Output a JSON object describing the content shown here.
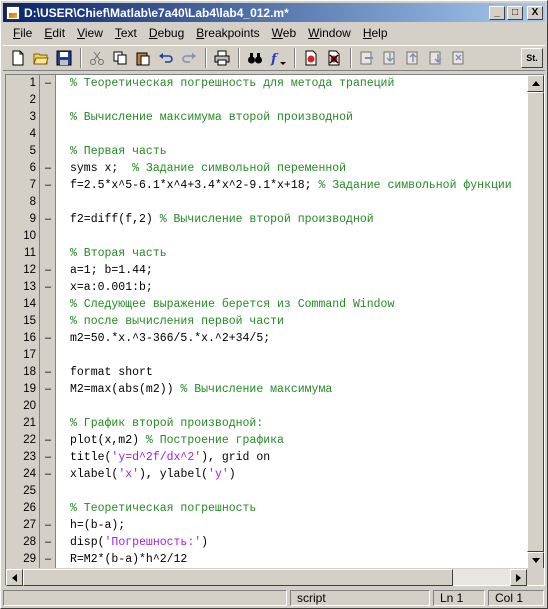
{
  "window": {
    "title": "D:\\USER\\Chief\\Matlab\\e7a40\\Lab4\\lab4_012.m*",
    "minimize": "_",
    "maximize": "□",
    "close": "X"
  },
  "menu": [
    {
      "label": "File"
    },
    {
      "label": "Edit"
    },
    {
      "label": "View"
    },
    {
      "label": "Text"
    },
    {
      "label": "Debug"
    },
    {
      "label": "Breakpoints"
    },
    {
      "label": "Web"
    },
    {
      "label": "Window"
    },
    {
      "label": "Help"
    }
  ],
  "toolbar": {
    "stack_label": "St."
  },
  "editor": {
    "lines": [
      {
        "n": "1",
        "dash": "–",
        "parts": [
          {
            "t": "% Теоретическая погрешность для метода трапеций",
            "c": "cm"
          }
        ]
      },
      {
        "n": "2",
        "dash": "",
        "parts": []
      },
      {
        "n": "3",
        "dash": "",
        "parts": [
          {
            "t": "% Вычисление максимума второй производной",
            "c": "cm"
          }
        ]
      },
      {
        "n": "4",
        "dash": "",
        "parts": []
      },
      {
        "n": "5",
        "dash": "",
        "parts": [
          {
            "t": "% Первая часть",
            "c": "cm"
          }
        ]
      },
      {
        "n": "6",
        "dash": "–",
        "parts": [
          {
            "t": "syms x;  ",
            "c": ""
          },
          {
            "t": "% Задание символьной переменной",
            "c": "cm"
          }
        ]
      },
      {
        "n": "7",
        "dash": "–",
        "parts": [
          {
            "t": "f=2.5*x^5-6.1*x^4+3.4*x^2-9.1*x+18; ",
            "c": ""
          },
          {
            "t": "% Задание символьной функции",
            "c": "cm"
          }
        ]
      },
      {
        "n": "8",
        "dash": "",
        "parts": []
      },
      {
        "n": "9",
        "dash": "–",
        "parts": [
          {
            "t": "f2=diff(f,2) ",
            "c": ""
          },
          {
            "t": "% Вычисление второй производной",
            "c": "cm"
          }
        ]
      },
      {
        "n": "10",
        "dash": "",
        "parts": []
      },
      {
        "n": "11",
        "dash": "",
        "parts": [
          {
            "t": "% Вторая часть",
            "c": "cm"
          }
        ]
      },
      {
        "n": "12",
        "dash": "–",
        "parts": [
          {
            "t": "a=1; b=1.44;",
            "c": ""
          }
        ]
      },
      {
        "n": "13",
        "dash": "–",
        "parts": [
          {
            "t": "x=a:0.001:b;",
            "c": ""
          }
        ]
      },
      {
        "n": "14",
        "dash": "",
        "parts": [
          {
            "t": "% Следующее выражение берется из Command Window",
            "c": "cm"
          }
        ]
      },
      {
        "n": "15",
        "dash": "",
        "parts": [
          {
            "t": "% после вычисления первой части",
            "c": "cm"
          }
        ]
      },
      {
        "n": "16",
        "dash": "–",
        "parts": [
          {
            "t": "m2=50.*x.^3-366/5.*x.^2+34/5;",
            "c": ""
          }
        ]
      },
      {
        "n": "17",
        "dash": "",
        "parts": []
      },
      {
        "n": "18",
        "dash": "–",
        "parts": [
          {
            "t": "format short",
            "c": ""
          }
        ]
      },
      {
        "n": "19",
        "dash": "–",
        "parts": [
          {
            "t": "M2=max(abs(m2)) ",
            "c": ""
          },
          {
            "t": "% Вычисление максимума",
            "c": "cm"
          }
        ]
      },
      {
        "n": "20",
        "dash": "",
        "parts": []
      },
      {
        "n": "21",
        "dash": "",
        "parts": [
          {
            "t": "% График второй производной:",
            "c": "cm"
          }
        ]
      },
      {
        "n": "22",
        "dash": "–",
        "parts": [
          {
            "t": "plot(x,m2) ",
            "c": ""
          },
          {
            "t": "% Построение графика",
            "c": "cm"
          }
        ]
      },
      {
        "n": "23",
        "dash": "–",
        "parts": [
          {
            "t": "title(",
            "c": ""
          },
          {
            "t": "'y=d^2f/dx^2'",
            "c": "str"
          },
          {
            "t": "), grid on",
            "c": ""
          }
        ]
      },
      {
        "n": "24",
        "dash": "–",
        "parts": [
          {
            "t": "xlabel(",
            "c": ""
          },
          {
            "t": "'x'",
            "c": "str"
          },
          {
            "t": "), ylabel(",
            "c": ""
          },
          {
            "t": "'y'",
            "c": "str"
          },
          {
            "t": ")",
            "c": ""
          }
        ]
      },
      {
        "n": "25",
        "dash": "",
        "parts": []
      },
      {
        "n": "26",
        "dash": "",
        "parts": [
          {
            "t": "% Теоретическая погрешность",
            "c": "cm"
          }
        ]
      },
      {
        "n": "27",
        "dash": "–",
        "parts": [
          {
            "t": "h=(b-a);",
            "c": ""
          }
        ]
      },
      {
        "n": "28",
        "dash": "–",
        "parts": [
          {
            "t": "disp(",
            "c": ""
          },
          {
            "t": "'Погрешность:'",
            "c": "str"
          },
          {
            "t": ")",
            "c": ""
          }
        ]
      },
      {
        "n": "29",
        "dash": "–",
        "parts": [
          {
            "t": "R=M2*(b-a)*h^2/12",
            "c": ""
          }
        ]
      }
    ]
  },
  "status": {
    "mode": "script",
    "line": "Ln 1",
    "col": "Col 1"
  },
  "colors": {
    "comment": "#228b22",
    "string": "#a020f0",
    "title_start": "#0a246a",
    "title_end": "#a6caf0"
  }
}
